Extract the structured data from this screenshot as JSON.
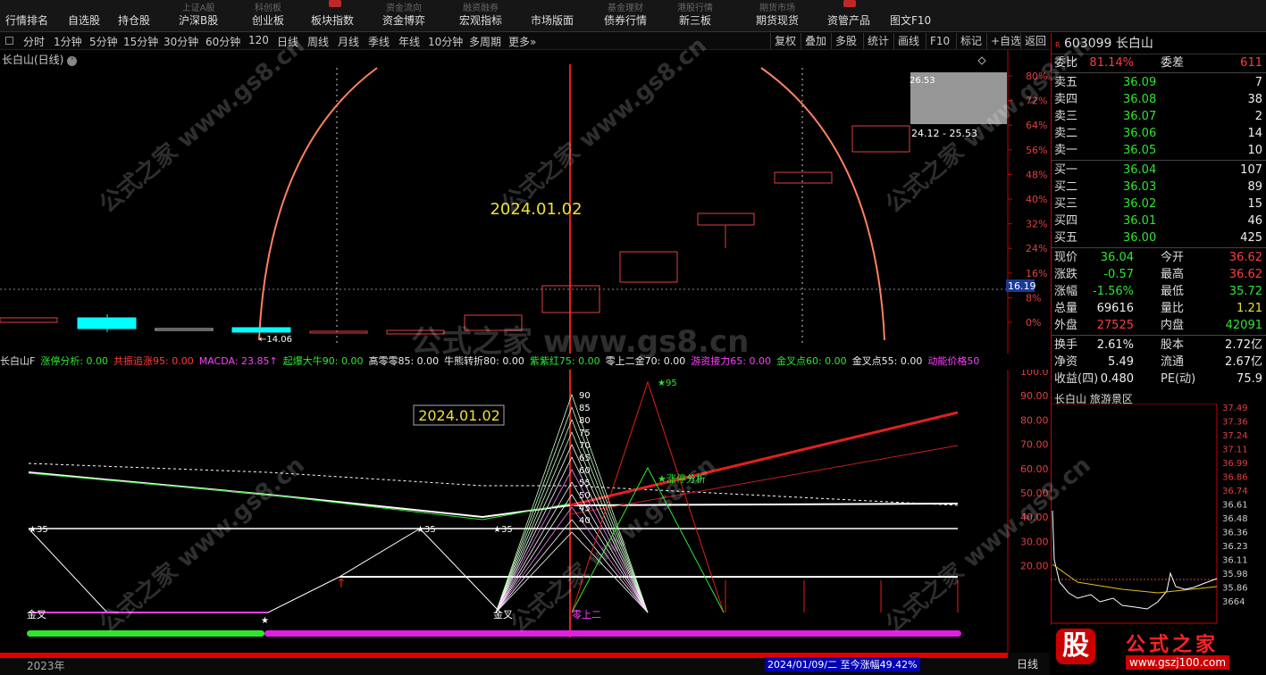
{
  "toolbar": {
    "items": [
      "行情排名",
      "自选股",
      "持仓股",
      "沪深B股",
      "创业板",
      "板块指数",
      "资金博弈",
      "宏观指标",
      "市场版面",
      "债券行情",
      "新三板",
      "期货现货",
      "资管产品",
      "图文F10"
    ],
    "tops": [
      "",
      "",
      "",
      "上证A股",
      "科创板",
      "",
      "资金流向",
      "融资融券",
      "",
      "基金理财",
      "港股行情",
      "期货市场",
      "",
      ""
    ]
  },
  "periods": [
    "分时",
    "1分钟",
    "5分钟",
    "15分钟",
    "30分钟",
    "60分钟",
    "120",
    "日线",
    "周线",
    "月线",
    "季线",
    "年线",
    "10分钟",
    "多周期",
    "更多"
  ],
  "right_buttons": [
    "复权",
    "叠加",
    "多股",
    "统计",
    "画线",
    "F10",
    "标记",
    "+自选",
    "返回"
  ],
  "chart": {
    "title": "长白山(日线)",
    "date_label": "2024.01.02",
    "price_tag": "16.19",
    "low_label": "←14.06",
    "range_label": "24.12 - 25.53",
    "box_label": "26.53",
    "y_ticks": [
      "80%",
      "72%",
      "64%",
      "56%",
      "48%",
      "40%",
      "32%",
      "24%",
      "16%",
      "8%",
      "0%"
    ]
  },
  "indicator": {
    "items": [
      {
        "text": "长白山F",
        "color": "#dddddd"
      },
      {
        "text": "涨停分析: 0.00",
        "color": "#2ee62e"
      },
      {
        "text": "共振追涨95: 0.00",
        "color": "#ff3c3c"
      },
      {
        "text": "MACDA: 23.85↑",
        "color": "#ff40ff"
      },
      {
        "text": "起爆大牛90: 0.00",
        "color": "#2ee62e"
      },
      {
        "text": "高零零85: 0.00",
        "color": "#eeeeee"
      },
      {
        "text": "牛熊转折80: 0.00",
        "color": "#eeeeee"
      },
      {
        "text": "紫紫红75: 0.00",
        "color": "#2ee62e"
      },
      {
        "text": "零上二金70: 0.00",
        "color": "#eeeeee"
      },
      {
        "text": "游资接力65: 0.00",
        "color": "#ff40ff"
      },
      {
        "text": "金叉点60: 0.00",
        "color": "#2ee62e"
      },
      {
        "text": "金叉点55: 0.00",
        "color": "#eeeeee"
      },
      {
        "text": "动能价格50",
        "color": "#ff40ff"
      }
    ],
    "date_label": "2024.01.02",
    "y_ticks": [
      "100.0",
      "90.00",
      "80.00",
      "70.00",
      "60.00",
      "50.00",
      "40.00",
      "30.00",
      "20.00"
    ],
    "star_labels": [
      "95",
      "90",
      "85",
      "80",
      "75",
      "70",
      "65",
      "60",
      "55",
      "50",
      "45",
      "40"
    ],
    "star_35": "35",
    "jincha": "金叉",
    "lingshang": "零上二",
    "zhangting": "涨停分析"
  },
  "quote": {
    "code": "603099",
    "name": "长白山",
    "weibi_label": "委比",
    "weibi": "81.14%",
    "weicha_label": "委差",
    "weicha": "611",
    "sells": [
      {
        "label": "卖五",
        "price": "36.09",
        "vol": "7"
      },
      {
        "label": "卖四",
        "price": "36.08",
        "vol": "38"
      },
      {
        "label": "卖三",
        "price": "36.07",
        "vol": "2"
      },
      {
        "label": "卖二",
        "price": "36.06",
        "vol": "14"
      },
      {
        "label": "卖一",
        "price": "36.05",
        "vol": "10"
      }
    ],
    "buys": [
      {
        "label": "买一",
        "price": "36.04",
        "vol": "107"
      },
      {
        "label": "买二",
        "price": "36.03",
        "vol": "89"
      },
      {
        "label": "买三",
        "price": "36.02",
        "vol": "15"
      },
      {
        "label": "买四",
        "price": "36.01",
        "vol": "46"
      },
      {
        "label": "买五",
        "price": "36.00",
        "vol": "425"
      }
    ],
    "stats": [
      {
        "l1": "现价",
        "v1": "36.04",
        "c1": "green",
        "l2": "今开",
        "v2": "36.62",
        "c2": "red"
      },
      {
        "l1": "涨跌",
        "v1": "-0.57",
        "c1": "green",
        "l2": "最高",
        "v2": "36.62",
        "c2": "red"
      },
      {
        "l1": "涨幅",
        "v1": "-1.56%",
        "c1": "green",
        "l2": "最低",
        "v2": "35.72",
        "c2": "green"
      },
      {
        "l1": "总量",
        "v1": "69616",
        "c1": "white",
        "l2": "量比",
        "v2": "1.21",
        "c2": "yellow"
      },
      {
        "l1": "外盘",
        "v1": "27525",
        "c1": "red",
        "l2": "内盘",
        "v2": "42091",
        "c2": "green"
      }
    ],
    "stats2": [
      {
        "l1": "换手",
        "v1": "2.61%",
        "l2": "股本",
        "v2": "2.72亿"
      },
      {
        "l1": "净资",
        "v1": "5.49",
        "l2": "流通",
        "v2": "2.67亿"
      },
      {
        "l1": "收益(四)",
        "v1": "0.480",
        "l2": "PE(动)",
        "v2": "75.9"
      }
    ],
    "mini_title": "长白山  旅游景区",
    "mini_ticks": [
      "37.49",
      "37.36",
      "37.24",
      "37.11",
      "36.99",
      "36.86",
      "36.74",
      "36.61",
      "36.48",
      "36.36",
      "36.23",
      "36.11",
      "35.98",
      "35.86",
      "3664"
    ]
  },
  "bottom": {
    "year": "2023年",
    "status": "2024/01/09/二  至今涨幅49.42%",
    "period": "日线"
  },
  "watermark": {
    "cn": "公式之家",
    "url": "www.gs8.cn",
    "logo_char": "股",
    "logo_text": "公式之家",
    "logo_url": "www.gszj100.com"
  }
}
